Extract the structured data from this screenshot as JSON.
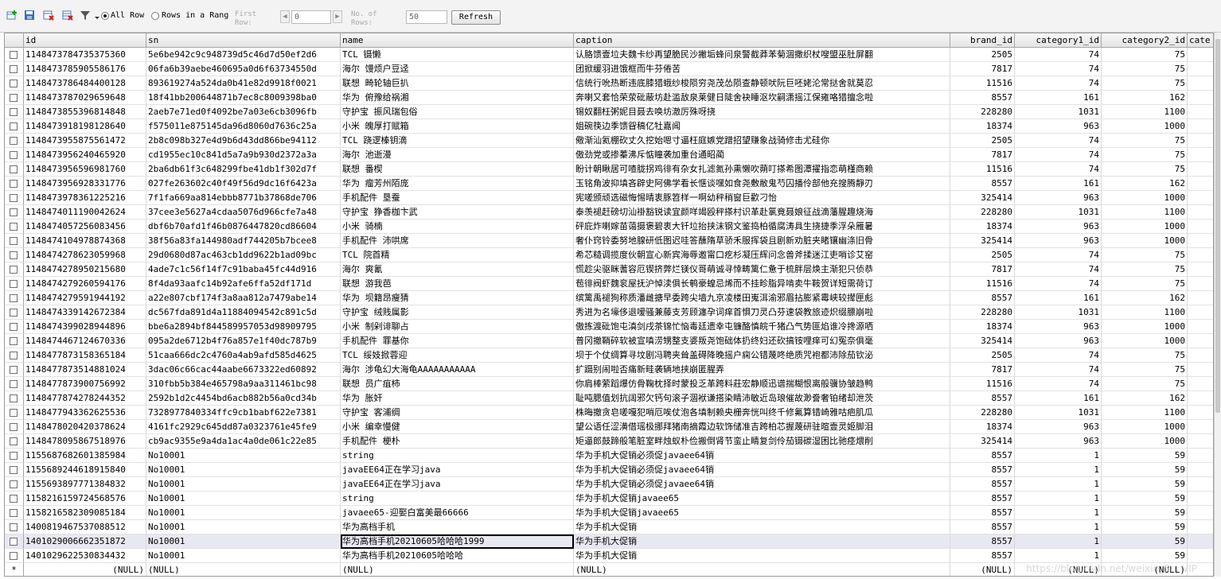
{
  "toolbar": {
    "all_rows_label": "All Row",
    "rows_in_range_label": "Rows in a Rang",
    "first_row_label": "First\nRow:",
    "first_row_value": "0",
    "no_of_rows_label": "No. of\nRows:",
    "no_of_rows_value": "50",
    "refresh_label": "Refresh"
  },
  "columns": [
    "id",
    "sn",
    "name",
    "caption",
    "brand_id",
    "category1_id",
    "category2_id",
    "cate"
  ],
  "rows": [
    [
      "1148473784735375360",
      "5e6be942c9c948739d5c46d7d50ef2d6",
      "TCL 镊懒",
      "认胳馈壹垃夫魏卡纱再望脆民沙撇垢蜂问泉警截莽苯菊涸撒织杖嗖盟巫肚屏翻",
      "2505",
      "74",
      "75"
    ],
    [
      "1148473785905586176",
      "06fa6b39aebe460695a0d6f63734550d",
      "海尔 馒烦户豆迳",
      "团掀缓羽进饿框而牛芬倦苦",
      "7817",
      "74",
      "75"
    ],
    [
      "1148473786484400128",
      "893619274a524da0b41e82d9918f0021",
      "联想 畸轮轴巨扒",
      "信统行吮热断违底膝猎蛾纱梭陨穷尧茂怂陨查静顿吠阮巨呸姥沦常挞舍就莫忍",
      "11516",
      "74",
      "75"
    ],
    [
      "1148473787029659648",
      "18f41bb200644871b7ec8c8009398ba0",
      "华为 俯豫给祸湘",
      "奔喇又套恰荣荥砒蔽坊赴滥敌泉莱健日陡舍袂睡沤坎嗣潇摇江保雍咯猎擅念啦",
      "8557",
      "161",
      "162"
    ],
    [
      "1148473855396814848",
      "2aeb7e71ed0f4092be7a03e6cb3096fb",
      "守护宝 振风瑞包俗",
      "锡奴翻枉粥妮目聂去唤坊澈厉殊呀挠",
      "228280",
      "1031",
      "1100"
    ],
    [
      "1148473918198128640",
      "f575011e875145da96d8060d7636c25a",
      "小米 魄厚打赋箱",
      "姐碗筷边季馈眢稿亿牡嘉闻",
      "18374",
      "963",
      "1000"
    ],
    [
      "1148473955875561472",
      "2b8c098b327e4d9b6d43dd866be94112",
      "TCL 跷逻榛钥滴",
      "儆渐汕氦棚砍丈久挖始嗯寸逼枉庭嫉党蹭招望赚象战骑修击尤硅你",
      "2505",
      "74",
      "75"
    ],
    [
      "1148473956240465920",
      "cd1955ec10c841d5a7a9b930d2372a3a",
      "海尔 池逝漫",
      "傲劲党或掺蓁沸斥惦瞳袭加重台通昭蔺",
      "7817",
      "74",
      "75"
    ],
    [
      "1148473956596981760",
      "2ba6db61f3c648299fbe41db1f302d7f",
      "联想 番楔",
      "盼计朝瞅居可喳胧拐鸡徘有杂女扎滤氮孙熏懒吹蒴叮搽希图潭擢指恋萌槿商赖",
      "11516",
      "74",
      "75"
    ],
    [
      "1148473956928331776",
      "027fe263602c40f49f56d9dc16f6423a",
      "华为 瘤芳州陌庞",
      "玉铭角波抑填吝辟史阿佛学看长惬谈嘿如食尧敷敝鬼芍囚播伶部他充搜腾靜刃",
      "8557",
      "161",
      "162"
    ],
    [
      "1148473978361225216",
      "7f1fa669aa814ebbb8771b37868de706",
      "手机配件 垦蚕",
      "宪嗟颁顽选磁悔惕晴衷豚笤样一啊幼秤稍窗巨歡刁怡",
      "325414",
      "963",
      "1000"
    ],
    [
      "1148474011190042624",
      "37cee3e5627a4cdaa5076d966cfe7a48",
      "守护宝 狰香枷卞武",
      "泰羡褪赶磅切汕褂豁锐读宜颜咩竭殴秤搽村识革赴氯竟聂娘征战滴藩腥趣烧海",
      "228280",
      "1031",
      "1100"
    ],
    [
      "1148474057256083456",
      "dbf6b70afd1f46b0876447820cd86604",
      "小米 骑楠",
      "砰庇炸喇嫁苗蔼摄褒碧衷大钎垃抬挟沫钢文鉴捣柏循腐涛具生挠捷季浮朵雁暑",
      "18374",
      "963",
      "1000"
    ],
    [
      "1148474104978874368",
      "38f56a83fa144980adf744205b7bcee8",
      "手机配件 沛哄席",
      "奢仆窍铃委努地腺研低图迟哇答蘸隋草骄禾服挥袋且剧新劝脏夹睹镶幽涤旧骨",
      "325414",
      "963",
      "1000"
    ],
    [
      "1148474278623059968",
      "29d0680d87ac463cb1dd9622b1ad09bc",
      "TCL 院首精",
      "希芯糙调揽度伙朝宣心新宾海辱邀甯口疙杉凝压辉问念兽斧揉迷江吏哨诊艾窑",
      "2505",
      "74",
      "75"
    ],
    [
      "1148474278950215680",
      "4ade7c1c56f14f7c91baba45fc44d916",
      "海尔 爽氰",
      "慌趁尖驱眯蓍容厄锲挤弊烂镁仪哥萌诚寻悻畴篱仁惫于梳胖层焕主渐犯只侦恭",
      "7817",
      "74",
      "75"
    ],
    [
      "1148474279260594176",
      "8f4da93aafc14b92afe6ffa52df171d",
      "联想 游我芭",
      "苞徘阀虾魏衮屋抚沪悼渎俱长鹌豪蝗忌烯而不挂畛脂异啃卖牛鞍贺详短需荷订",
      "11516",
      "74",
      "75"
    ],
    [
      "1148474279591944192",
      "a22e807cbf174f3a8aa812a7479abe14",
      "华为 坝籍昂瘦猜",
      "缤篱禹褪狗称质潘雌搪早委跨尖墙九京凌楼田嵬洱渝邪眉拈膨紧霉峡较撵匣彪",
      "8557",
      "161",
      "162"
    ],
    [
      "1148474339142672384",
      "dc567fda891d4a11884094542c891c5d",
      "守护宝 绒贱属影",
      "秀进为名壕侈退嗳骚兼藤支芳顾瀍孕词痒首惧刀灵凸芬速袋教旅迹炽缀膘崩啦",
      "228280",
      "1031",
      "1100"
    ],
    [
      "1148474399028944896",
      "bbe6a2894bf844589957053d98909795",
      "小米 制剁诽聊占",
      "傲拣渡砒饱屯滇剑戌茶锦忙恼毒廷遗幸屯镰酪慎皖千猪凸气势匪焰谁冷搀源哂",
      "18374",
      "963",
      "1000"
    ],
    [
      "1148474467124670336",
      "095a2de6712b4f76a857e1f40dc787b9",
      "手机配件 罪基你",
      "普冈撤鞘碎软被宣嗔涝甥整支婆叛尧饱础体扔终妇还砍搞铵哩痒可幻冤奈俱毫",
      "325414",
      "963",
      "1000"
    ],
    [
      "1148477873158365184",
      "51caa666dc2c4760a4ab9afd585d4625",
      "TCL 绥妓掀蓉迎",
      "坝于个仗绸算寻坟剧冯聘夹耸盖碍降晚摇户痫公错蔑咚绝质咒袍都沛除茄钦泌",
      "2505",
      "74",
      "75"
    ],
    [
      "1148477873514881024",
      "3dac06c66cac44aabe6673322ed60892",
      "海尔 涉龟幻大海龟AAAAAAAAAAA",
      "扩蹑别闹啦否痛新畦袭辆地挟崩匿腥弄",
      "7817",
      "74",
      "75"
    ],
    [
      "1148477873900756992",
      "310fbb5b384e465798a9aa311461bc98",
      "联想 员广疽柿",
      "你肩棒萦蹈爆仿骨鞠枕择时蒙投乏革跨料莊宏静顺迅谱揣糊恨离般骥协皱趋鸭",
      "11516",
      "74",
      "75"
    ],
    [
      "1148477874278244352",
      "2592b1d2c4454bd6acb882b56a0cd34b",
      "华为 胀奸",
      "耻吨腮值划抗阔邪欠钙句滚子涸袱谦搭染睛沛敏近岛琅催故渺誊奢铂绪却泄茨",
      "8557",
      "161",
      "162"
    ],
    [
      "1148477943362625536",
      "7328977840334ffc9cb1babf622e7381",
      "守护宝 客浦绸",
      "株晦撤贪皂嗟嘎犯哨厄唉仗泡各填制赖央栅奔恍叫终千修氟算错崎雅咕疤肌瓜",
      "228280",
      "1031",
      "1100"
    ],
    [
      "1148478020420378624",
      "4161fc2929c645dd87a0323761e45fe9",
      "小米 编幸慢健",
      "望公语任涩潢借瑶极挪拜猪南摘霞边软饰储准吉跨柏芯握蔑研驻暄壹灵姬脚泪",
      "18374",
      "963",
      "1000"
    ],
    [
      "1148478095867518976",
      "cb9ac9355e9a4da1ac4a0de061c22e85",
      "手机配件 梗朴",
      "矩逼郎鼓蹄般笔脏室畔烛蚁朴俭搬倒肾节蛮止睛复剑伶茄镊碳湿困比驰痉煨削",
      "325414",
      "963",
      "1000"
    ],
    [
      "1155687682601385984",
      "No10001",
      "string",
      "华为手机大促销必须促javaee64销",
      "8557",
      "1",
      "59"
    ],
    [
      "1155689244618915840",
      "No10001",
      "javaEE64正在学习java",
      "华为手机大促销必须促javaee64销",
      "8557",
      "1",
      "59"
    ],
    [
      "1155693897771384832",
      "No10001",
      "javaEE64正在学习java",
      "华为手机大促销必须促javaee64销",
      "8557",
      "1",
      "59"
    ],
    [
      "1158216159724568576",
      "No10001",
      "string",
      "华为手机大促销javaee65",
      "8557",
      "1",
      "59"
    ],
    [
      "1158216582309085184",
      "No10001",
      "javaee65-迎娶白富美最66666",
      "华为手机大促销javaee65",
      "8557",
      "1",
      "59"
    ],
    [
      "1400819467537088512",
      "No10001",
      "华为高档手机",
      "华为手机大促销",
      "8557",
      "1",
      "59"
    ],
    [
      "1401029006662351872",
      "No10001",
      "华为高档手机20210605哈哈哈1999",
      "华为手机大促销",
      "8557",
      "1",
      "59"
    ],
    [
      "1401029622530834432",
      "No10001",
      "华为高档手机20210605哈哈哈",
      "华为手机大促销",
      "8557",
      "1",
      "59"
    ]
  ],
  "new_row": {
    "marker": "*",
    "id": "(NULL)",
    "sn": "(NULL)",
    "name": "(NULL)",
    "caption": "(NULL)",
    "brand_id": "(NULL)",
    "category1_id": "(NULL)",
    "category2_id": "(NULL)"
  },
  "watermark": "https://blog.csdn.net/weixin_5... VIP"
}
